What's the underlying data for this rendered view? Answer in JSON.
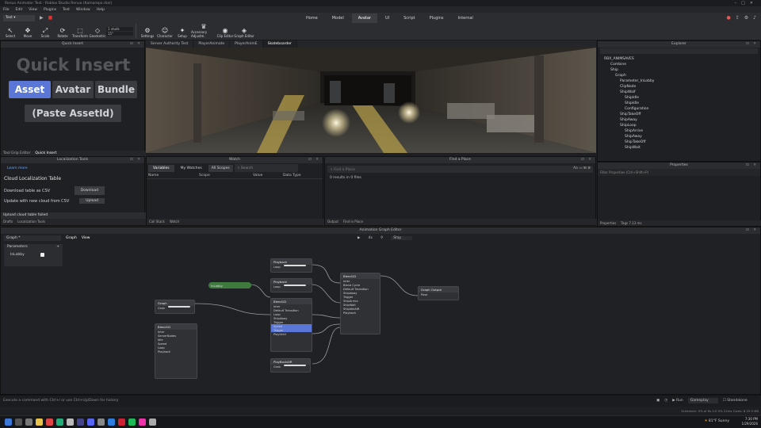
{
  "titlebar": {
    "title": "Renuo Animator Test - Roblox Studio Renuo (Kamarepo.rbxl)"
  },
  "menu": [
    "File",
    "Edit",
    "View",
    "Plugins",
    "Test",
    "Window",
    "Help"
  ],
  "ribbon_tabs": [
    "Home",
    "Model",
    "Avatar",
    "UI",
    "Script",
    "Plugins",
    "Internal"
  ],
  "active_ribbon_tab": "Avatar",
  "tools": [
    {
      "icon": "select-icon",
      "label": "Select",
      "glyph": "↖"
    },
    {
      "icon": "move-icon",
      "label": "Move",
      "glyph": "✥"
    },
    {
      "icon": "scale-icon",
      "label": "Scale",
      "glyph": "⤢"
    },
    {
      "icon": "rotate-icon",
      "label": "Rotate",
      "glyph": "⟳"
    },
    {
      "icon": "transform-icon",
      "label": "Transform",
      "glyph": "⬚"
    },
    {
      "icon": "geometric-icon",
      "label": "Geometric",
      "glyph": "◇"
    },
    {
      "icon": "settings-icon",
      "label": "Settings",
      "glyph": "⚙"
    },
    {
      "icon": "character-icon",
      "label": "Character",
      "glyph": "☺"
    },
    {
      "icon": "setup-icon",
      "label": "Setup",
      "glyph": "✦"
    },
    {
      "icon": "accessory-icon",
      "label": "Accessory Adjustm.",
      "glyph": "♛"
    },
    {
      "icon": "clip-editor-icon",
      "label": "Clip Editor",
      "glyph": "◉"
    },
    {
      "icon": "graph-editor-icon",
      "label": "Graph Editor",
      "glyph": "◈"
    }
  ],
  "ribbon_fields": {
    "stud": "1 studs",
    "angle": "15°"
  },
  "quick_insert": {
    "header": "Quick Insert",
    "title": "Quick Insert",
    "asset": "Asset",
    "avatar": "Avatar",
    "bundle": "Bundle",
    "paste": "(Paste AssetId)",
    "tabs": [
      "Tool Grip Editor",
      "Quick Insert"
    ]
  },
  "viewport_tabs": [
    "Server Authority Test",
    "PlayerAnimate",
    "PlayerAnimE",
    "Skateboarder"
  ],
  "explorer": {
    "header": "Explorer",
    "items": [
      "RBX_ANIMSAVES",
      "Combine",
      "Ship",
      "Graph",
      "Parameter_InLobby",
      "ClipNode",
      "ShipWalf",
      "ShipIdle",
      "ShipIdle",
      "Configuration",
      "ShipTakeOff",
      "ShipAway",
      "ShipLoop",
      "ShipArrive",
      "ShipAway",
      "ShipTakeOff",
      "ShipWait"
    ]
  },
  "properties": {
    "header": "Properties",
    "filter": "Filter Properties (Ctrl+Shift+P)",
    "tabs": [
      "Properties",
      "Tags 7.13 ms"
    ]
  },
  "localization": {
    "header": "Localization Tools",
    "learn": "Learn more",
    "cloud": "Cloud Localization Table",
    "download_label": "Download table as CSV",
    "download_btn": "Download",
    "update_label": "Update with new cloud from CSV",
    "upload_btn": "Upload",
    "failed": "Upload cloud table failed",
    "tabs": [
      "Drafts",
      "Localization Tools"
    ]
  },
  "watch": {
    "header": "Watch",
    "tabs": [
      "Variables",
      "My Watches",
      "All Scopes"
    ],
    "search": "Search",
    "cols": [
      "Name",
      "Scope",
      "Value",
      "Data Type"
    ],
    "bottom_tabs": [
      "Call Stack",
      "Watch"
    ]
  },
  "find_place": {
    "header": "Find a Place",
    "placeholder": "Find a Place",
    "results": "0 results in 0 files",
    "bottom_tabs": [
      "Output",
      "Find in Place"
    ]
  },
  "anim_graph": {
    "header": "Animation Graph Editor",
    "graph_select": "Graph *",
    "graph_tab": "Graph",
    "view_tab": "View",
    "right_controls": [
      "4x",
      "Ship"
    ],
    "parameters_label": "Parameters",
    "param_name": "InLobby",
    "green_node": "InLobby",
    "nodes": [
      {
        "title": "Playback",
        "rows": [
          "Loop"
        ]
      },
      {
        "title": "Playback",
        "rows": [
          "Loop"
        ]
      },
      {
        "title": "Blend1D",
        "rows": [
          "Inter",
          "Default Transition",
          "Loop",
          "ShipAway",
          "Trigger",
          "Speed",
          "Trigger",
          "PlayUntil"
        ]
      },
      {
        "title": "Blend1D",
        "rows": [
          "Inter",
          "Blend Cycle",
          "Default Transition",
          "ShipAway",
          "Trigger",
          "ShipArrive",
          "ShipWait",
          "ShipIdleAIR",
          "Playback"
        ]
      },
      {
        "title": "Graph Output",
        "rows": [
          "Pose"
        ]
      },
      {
        "title": "Graph",
        "rows": [
          "Grab"
        ]
      },
      {
        "title": "Blend1D",
        "rows": [
          "Inter",
          "ServerNodes",
          "Idle",
          "Speed",
          "Loop",
          "Playback"
        ]
      },
      {
        "title": "PlayBackAIR",
        "rows": [
          "Grab"
        ]
      }
    ]
  },
  "cmd": {
    "placeholder": "Execute a command with Ctrl+/ or use Ctrl+Up/Down for history"
  },
  "status": {
    "run": "Run",
    "mode": "Gameplay",
    "standalone": "Standalone",
    "stats": "Scheduler: 0% of 6s  0.0  0% 22ms  Cores: 8  25.9 MB"
  },
  "taskbar": {
    "weather": "81°F Sunny",
    "time": "7:30 PM",
    "date": "1/29/2026"
  }
}
